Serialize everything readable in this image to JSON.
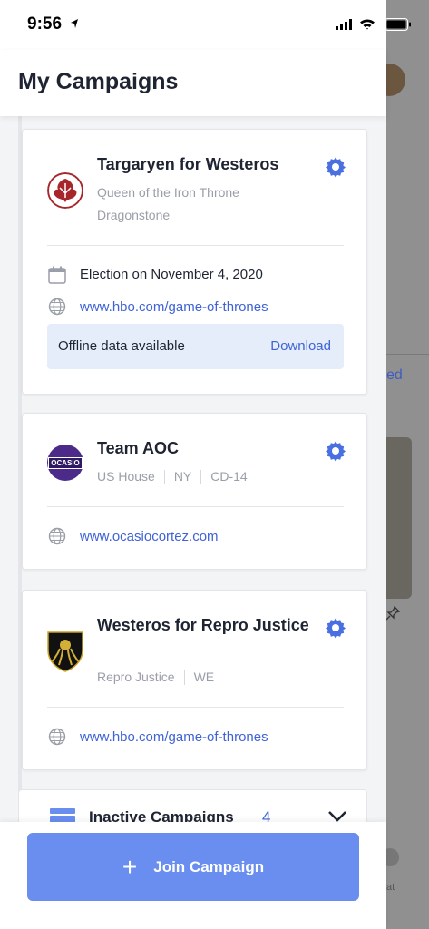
{
  "status_bar": {
    "time": "9:56"
  },
  "header": {
    "title": "My Campaigns"
  },
  "background": {
    "partial_text": "ed",
    "chat_label": "at"
  },
  "campaigns": [
    {
      "name": "Targaryen for Westeros",
      "meta": [
        "Queen of the Iron Throne",
        "Dragonstone"
      ],
      "election": "Election on November 4, 2020",
      "website": "www.hbo.com/game-of-thrones",
      "offline_text": "Offline data available",
      "offline_action": "Download",
      "logo_icon": "targaryen-dragon-sigil"
    },
    {
      "name": "Team AOC",
      "meta": [
        "US House",
        "NY",
        "CD-14"
      ],
      "website": "www.ocasiocortez.com",
      "logo_icon": "ocasio-cortez-badge",
      "logo_text": "OCASIO"
    },
    {
      "name": "Westeros for Repro Justice",
      "meta": [
        "Repro Justice",
        "WE"
      ],
      "website": "www.hbo.com/game-of-thrones",
      "logo_icon": "kraken-shield"
    }
  ],
  "inactive": {
    "label": "Inactive Campaigns",
    "count": "4"
  },
  "footer": {
    "join_label": "Join Campaign",
    "plus": "+"
  },
  "colors": {
    "accent": "#3f63d6",
    "button": "#6a8ef0",
    "offline_bg": "#e5edfb",
    "title": "#1f2433"
  }
}
